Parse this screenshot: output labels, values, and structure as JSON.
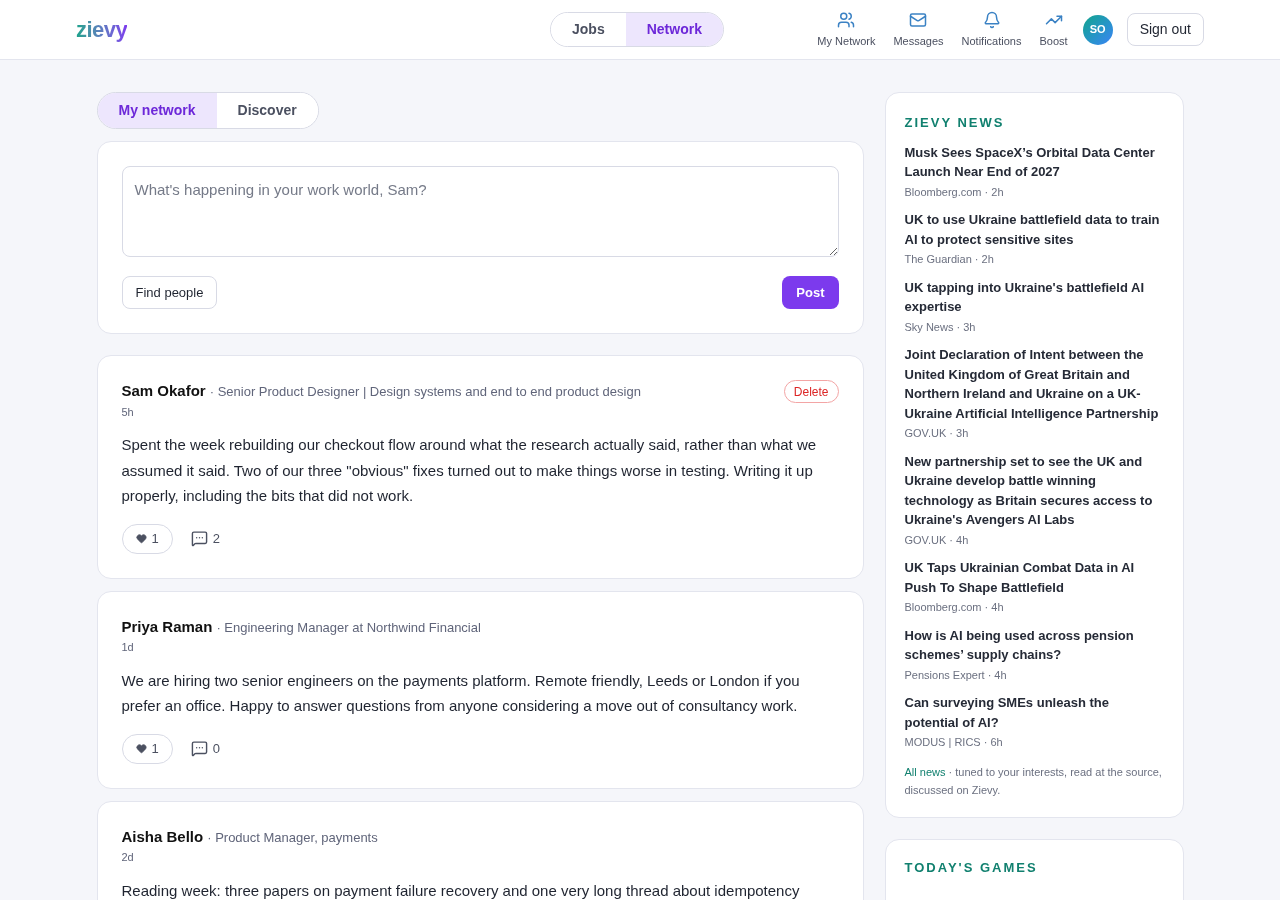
{
  "header": {
    "logo": "zievy",
    "switch": [
      {
        "label": "Jobs",
        "selected": false
      },
      {
        "label": "Network",
        "selected": true
      }
    ],
    "nav": [
      {
        "kind": "people",
        "label": "My Network"
      },
      {
        "kind": "mail",
        "label": "Messages"
      },
      {
        "kind": "bell",
        "label": "Notifications"
      },
      {
        "kind": "trend",
        "label": "Boost"
      }
    ],
    "avatar": "SO",
    "sign_out": "Sign out"
  },
  "feed_tabs": [
    {
      "label": "My network",
      "selected": true
    },
    {
      "label": "Discover",
      "selected": false
    }
  ],
  "composer": {
    "placeholder": "What's happening in your work world, Sam?",
    "find_people": "Find people",
    "post": "Post"
  },
  "posts": [
    {
      "author": "Sam Okafor",
      "headline": "· Senior Product Designer | Design systems and end to end product design",
      "time": "5h",
      "delete": "Delete",
      "body": "Spent the week rebuilding our checkout flow around what the research actually said, rather than what we assumed it said. Two of our three \"obvious\" fixes turned out to make things worse in testing. Writing it up properly, including the bits that did not work.",
      "likes": "1",
      "comments": "2"
    },
    {
      "author": "Priya Raman",
      "headline": "· Engineering Manager at Northwind Financial",
      "time": "1d",
      "body": "We are hiring two senior engineers on the payments platform. Remote friendly, Leeds or London if you prefer an office. Happy to answer questions from anyone considering a move out of consultancy work.",
      "likes": "1",
      "comments": "0"
    },
    {
      "author": "Aisha Bello",
      "headline": "· Product Manager, payments",
      "time": "2d",
      "body": "Reading week: three papers on payment failure recovery and one very long thread about idempotency"
    }
  ],
  "news": {
    "title": "ZIEVY NEWS",
    "items": [
      {
        "headline": "Musk Sees SpaceX’s Orbital Data Center Launch Near End of 2027",
        "source": "Bloomberg.com · 2h"
      },
      {
        "headline": "UK to use Ukraine battlefield data to train AI to protect sensitive sites",
        "source": "The Guardian · 2h"
      },
      {
        "headline": "UK tapping into Ukraine's battlefield AI expertise",
        "source": "Sky News · 3h"
      },
      {
        "headline": "Joint Declaration of Intent between the United Kingdom of Great Britain and Northern Ireland and Ukraine on a UK-Ukraine Artificial Intelligence Partnership",
        "source": "GOV.UK · 3h"
      },
      {
        "headline": "New partnership set to see the UK and Ukraine develop battle winning technology as Britain secures access to Ukraine's Avengers AI Labs",
        "source": "GOV.UK · 4h"
      },
      {
        "headline": "UK Taps Ukrainian Combat Data in AI Push To Shape Battlefield",
        "source": "Bloomberg.com · 4h"
      },
      {
        "headline": "How is AI being used across pension schemes’ supply chains?",
        "source": "Pensions Expert · 4h"
      },
      {
        "headline": "Can surveying SMEs unleash the potential of AI?",
        "source": "MODUS | RICS · 6h"
      }
    ],
    "all_news": "All news",
    "footer": "· tuned to your interests, read at the source, discussed on Zievy."
  },
  "games": {
    "title": "TODAY'S GAMES"
  }
}
